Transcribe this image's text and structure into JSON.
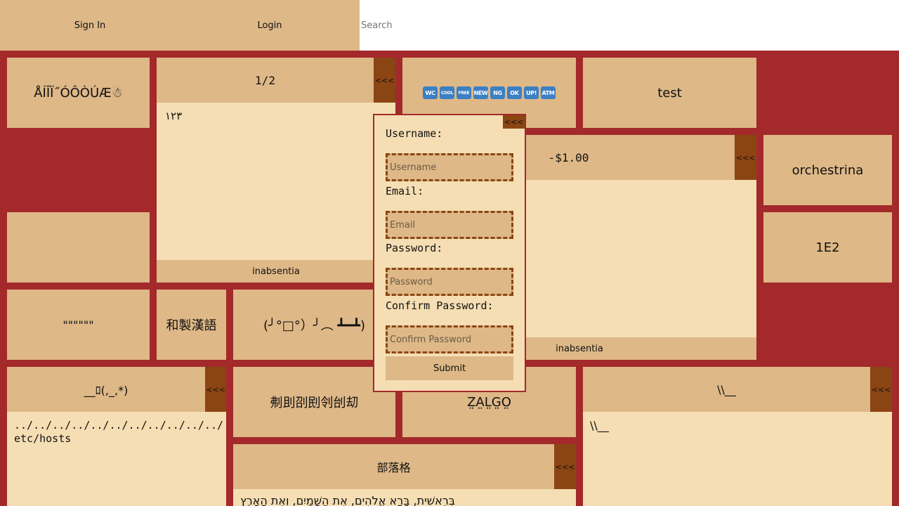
{
  "topbar": {
    "sign_in_label": "Sign In",
    "login_label": "Login",
    "search_placeholder": "Search"
  },
  "tiles": {
    "accented": "ÅÍÎÏ˝ÓÔÒÚÆ☃",
    "test": "test",
    "orchestrina": "orchestrina",
    "one_e2": "1E2",
    "quotes": "\"\"\"\"\"\"",
    "wasei_kango": "和製漢語",
    "table_flip": "(╯°□°）╯︵ ┻━┻)",
    "cjk_chars": "刜刞刟刡刢刣刧",
    "zalgo": "Z̤A̤L̤G̤O̤"
  },
  "emoji_badges": [
    "WC",
    "COOL",
    "FREE",
    "NEW",
    "NG",
    "OK",
    "UP!",
    "ATM"
  ],
  "collapse_label": "<<<",
  "panels": {
    "p1": {
      "header": "1/2",
      "body": "١٢٣",
      "footer": "inabsentia"
    },
    "p2": {
      "header": "-$1.00",
      "body": "",
      "footer": "inabsentia"
    },
    "p3": {
      "header": "__ﾛ(,_,*)",
      "body": "../../../../../../../../../../../etc/hosts"
    },
    "p4": {
      "header": "\\\\__",
      "body": "\\\\__"
    },
    "p5": {
      "header": "部落格",
      "body": "בְּרֵאשִׁית, בָּרָא אֱלֹהִים, אֵת הַשָּׁמַיִם, וְאֵת הָאָרֶץ"
    }
  },
  "form": {
    "username_label": "Username:",
    "username_placeholder": "Username",
    "email_label": "Email:",
    "email_placeholder": "Email",
    "password_label": "Password:",
    "password_placeholder": "Password",
    "confirm_label": "Confirm Password:",
    "confirm_placeholder": "Confirm Password",
    "submit_label": "Submit"
  },
  "colors": {
    "background": "#a3292b",
    "tile": "#deb887",
    "panel_body": "#f5deb3",
    "collapse_button": "#8b4513",
    "badge": "#3b7fc4"
  }
}
